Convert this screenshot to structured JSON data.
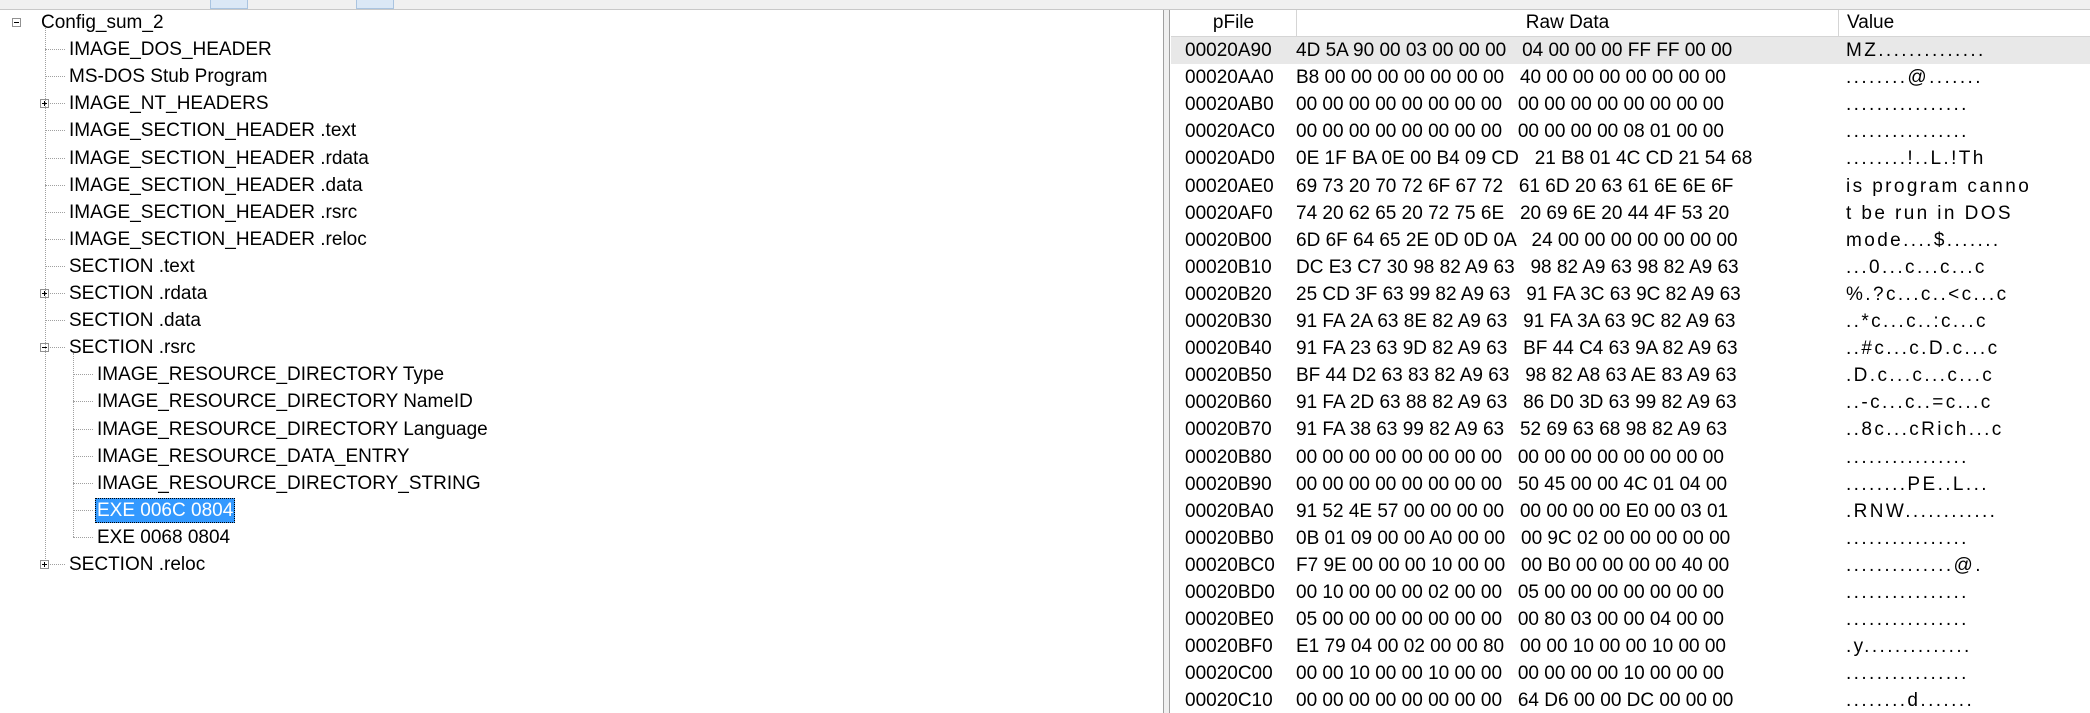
{
  "tree": {
    "root": "Config_sum_2",
    "items": [
      {
        "label": "IMAGE_DOS_HEADER",
        "depth": 1,
        "expander": "none"
      },
      {
        "label": "MS-DOS Stub Program",
        "depth": 1,
        "expander": "none"
      },
      {
        "label": "IMAGE_NT_HEADERS",
        "depth": 1,
        "expander": "plus"
      },
      {
        "label": "IMAGE_SECTION_HEADER .text",
        "depth": 1,
        "expander": "none"
      },
      {
        "label": "IMAGE_SECTION_HEADER .rdata",
        "depth": 1,
        "expander": "none"
      },
      {
        "label": "IMAGE_SECTION_HEADER .data",
        "depth": 1,
        "expander": "none"
      },
      {
        "label": "IMAGE_SECTION_HEADER .rsrc",
        "depth": 1,
        "expander": "none"
      },
      {
        "label": "IMAGE_SECTION_HEADER .reloc",
        "depth": 1,
        "expander": "none"
      },
      {
        "label": "SECTION .text",
        "depth": 1,
        "expander": "none"
      },
      {
        "label": "SECTION .rdata",
        "depth": 1,
        "expander": "plus"
      },
      {
        "label": "SECTION .data",
        "depth": 1,
        "expander": "none"
      },
      {
        "label": "SECTION .rsrc",
        "depth": 1,
        "expander": "minus"
      },
      {
        "label": "IMAGE_RESOURCE_DIRECTORY Type",
        "depth": 2,
        "expander": "none"
      },
      {
        "label": "IMAGE_RESOURCE_DIRECTORY NameID",
        "depth": 2,
        "expander": "none"
      },
      {
        "label": "IMAGE_RESOURCE_DIRECTORY Language",
        "depth": 2,
        "expander": "none"
      },
      {
        "label": "IMAGE_RESOURCE_DATA_ENTRY",
        "depth": 2,
        "expander": "none"
      },
      {
        "label": "IMAGE_RESOURCE_DIRECTORY_STRING",
        "depth": 2,
        "expander": "none"
      },
      {
        "label": "EXE  006C  0804",
        "depth": 2,
        "expander": "none",
        "selected": true
      },
      {
        "label": "EXE  0068  0804",
        "depth": 2,
        "expander": "none"
      },
      {
        "label": "SECTION .reloc",
        "depth": 1,
        "expander": "plus"
      }
    ]
  },
  "hexview": {
    "columns": {
      "offset": "pFile",
      "raw": "Raw Data",
      "value": "Value"
    },
    "rows": [
      {
        "offset": "00020A90",
        "hex": "4D 5A 90 00 03 00 00 00   04 00 00 00 FF FF 00 00",
        "ascii": "MZ.............."
      },
      {
        "offset": "00020AA0",
        "hex": "B8 00 00 00 00 00 00 00   40 00 00 00 00 00 00 00",
        "ascii": "........@......."
      },
      {
        "offset": "00020AB0",
        "hex": "00 00 00 00 00 00 00 00   00 00 00 00 00 00 00 00",
        "ascii": "................"
      },
      {
        "offset": "00020AC0",
        "hex": "00 00 00 00 00 00 00 00   00 00 00 00 08 01 00 00",
        "ascii": "................"
      },
      {
        "offset": "00020AD0",
        "hex": "0E 1F BA 0E 00 B4 09 CD   21 B8 01 4C CD 21 54 68",
        "ascii": "........!..L.!Th"
      },
      {
        "offset": "00020AE0",
        "hex": "69 73 20 70 72 6F 67 72   61 6D 20 63 61 6E 6E 6F",
        "ascii": "is program canno"
      },
      {
        "offset": "00020AF0",
        "hex": "74 20 62 65 20 72 75 6E   20 69 6E 20 44 4F 53 20",
        "ascii": "t be run in DOS "
      },
      {
        "offset": "00020B00",
        "hex": "6D 6F 64 65 2E 0D 0D 0A   24 00 00 00 00 00 00 00",
        "ascii": "mode....$......."
      },
      {
        "offset": "00020B10",
        "hex": "DC E3 C7 30 98 82 A9 63   98 82 A9 63 98 82 A9 63",
        "ascii": "...0...c...c...c"
      },
      {
        "offset": "00020B20",
        "hex": "25 CD 3F 63 99 82 A9 63   91 FA 3C 63 9C 82 A9 63",
        "ascii": "%.?c...c..<c...c"
      },
      {
        "offset": "00020B30",
        "hex": "91 FA 2A 63 8E 82 A9 63   91 FA 3A 63 9C 82 A9 63",
        "ascii": "..*c...c..:c...c"
      },
      {
        "offset": "00020B40",
        "hex": "91 FA 23 63 9D 82 A9 63   BF 44 C4 63 9A 82 A9 63",
        "ascii": "..#c...c.D.c...c"
      },
      {
        "offset": "00020B50",
        "hex": "BF 44 D2 63 83 82 A9 63   98 82 A8 63 AE 83 A9 63",
        "ascii": ".D.c...c...c...c"
      },
      {
        "offset": "00020B60",
        "hex": "91 FA 2D 63 88 82 A9 63   86 D0 3D 63 99 82 A9 63",
        "ascii": "..-c...c..=c...c"
      },
      {
        "offset": "00020B70",
        "hex": "91 FA 38 63 99 82 A9 63   52 69 63 68 98 82 A9 63",
        "ascii": "..8c...cRich...c"
      },
      {
        "offset": "00020B80",
        "hex": "00 00 00 00 00 00 00 00   00 00 00 00 00 00 00 00",
        "ascii": "................"
      },
      {
        "offset": "00020B90",
        "hex": "00 00 00 00 00 00 00 00   50 45 00 00 4C 01 04 00",
        "ascii": "........PE..L..."
      },
      {
        "offset": "00020BA0",
        "hex": "91 52 4E 57 00 00 00 00   00 00 00 00 E0 00 03 01",
        "ascii": ".RNW............"
      },
      {
        "offset": "00020BB0",
        "hex": "0B 01 09 00 00 A0 00 00   00 9C 02 00 00 00 00 00",
        "ascii": "................"
      },
      {
        "offset": "00020BC0",
        "hex": "F7 9E 00 00 00 10 00 00   00 B0 00 00 00 00 40 00",
        "ascii": "..............@."
      },
      {
        "offset": "00020BD0",
        "hex": "00 10 00 00 00 02 00 00   05 00 00 00 00 00 00 00",
        "ascii": "................"
      },
      {
        "offset": "00020BE0",
        "hex": "05 00 00 00 00 00 00 00   00 80 03 00 00 04 00 00",
        "ascii": "................"
      },
      {
        "offset": "00020BF0",
        "hex": "E1 79 04 00 02 00 00 80   00 00 10 00 00 10 00 00",
        "ascii": ".y.............."
      },
      {
        "offset": "00020C00",
        "hex": "00 00 10 00 00 10 00 00   00 00 00 00 10 00 00 00",
        "ascii": "................"
      },
      {
        "offset": "00020C10",
        "hex": "00 00 00 00 00 00 00 00   64 D6 00 00 DC 00 00 00",
        "ascii": "........d......."
      }
    ]
  }
}
